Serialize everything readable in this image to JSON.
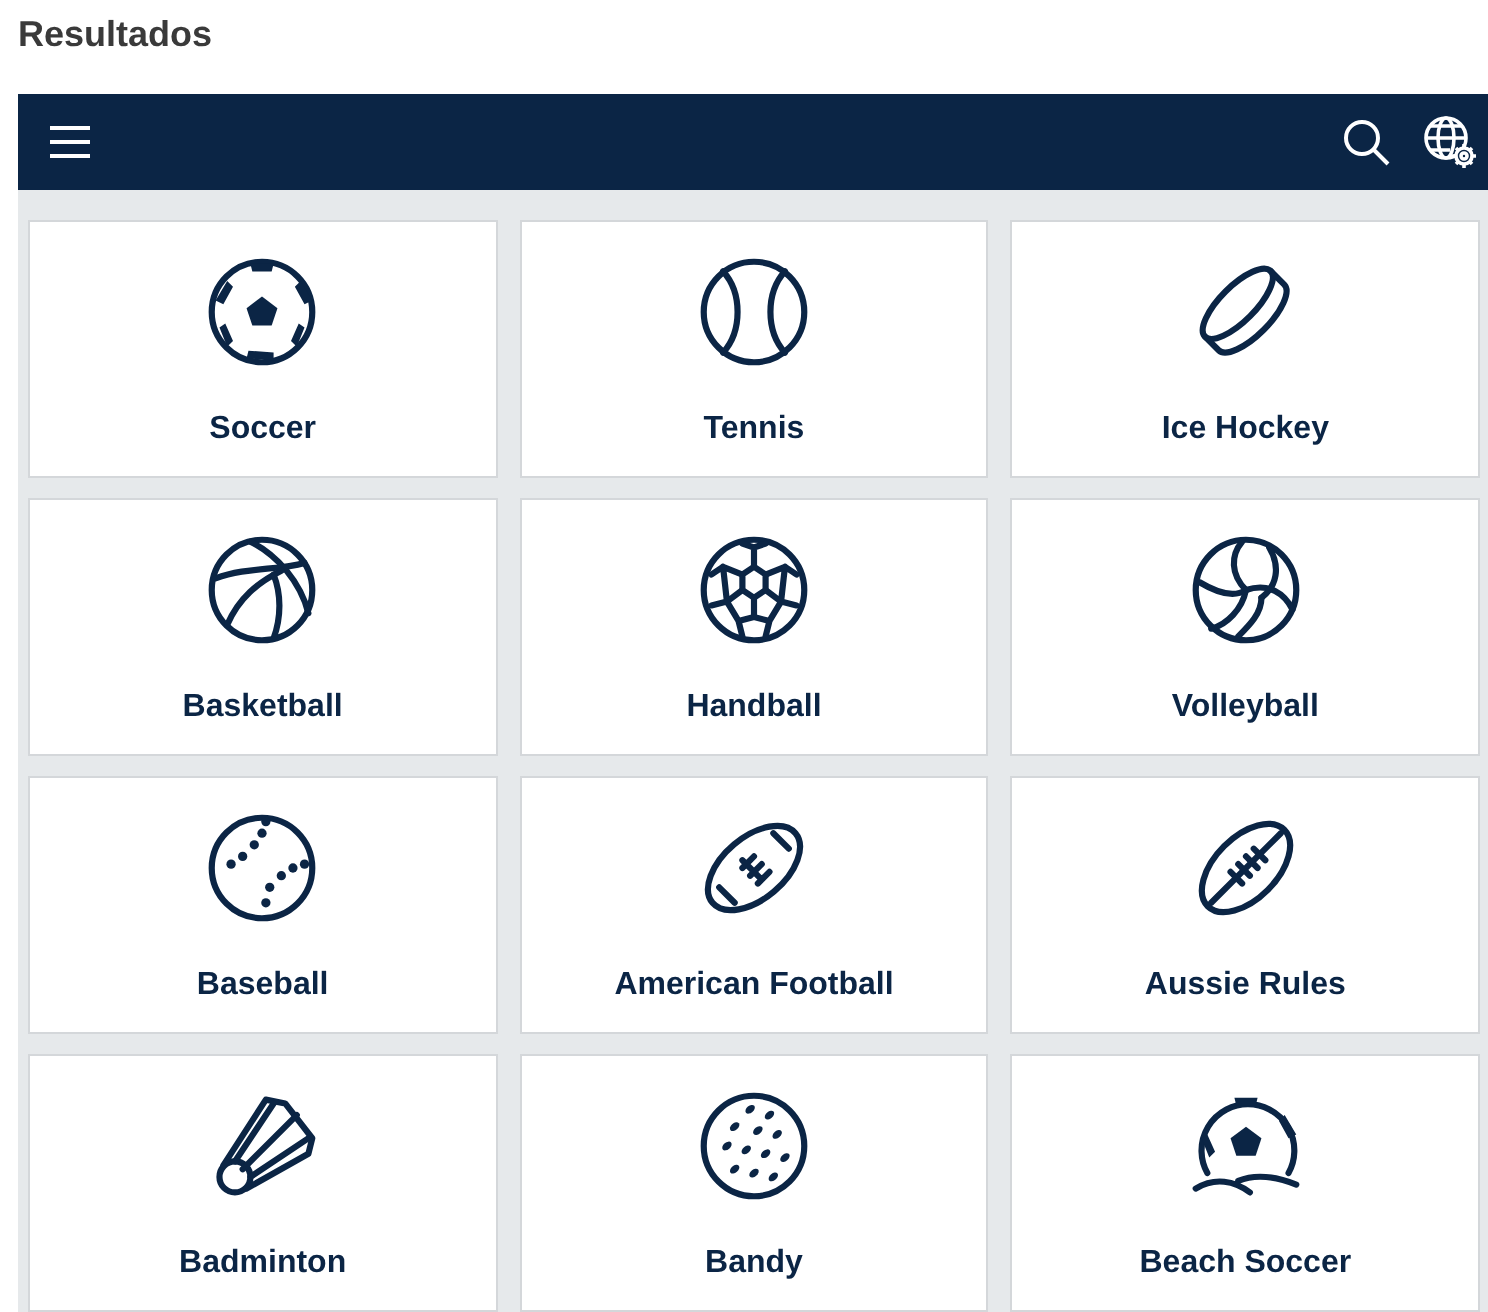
{
  "title": "Resultados",
  "sports": [
    {
      "label": "Soccer",
      "kind": "soccer"
    },
    {
      "label": "Tennis",
      "kind": "tennis"
    },
    {
      "label": "Ice Hockey",
      "kind": "puck"
    },
    {
      "label": "Basketball",
      "kind": "basketball"
    },
    {
      "label": "Handball",
      "kind": "handball"
    },
    {
      "label": "Volleyball",
      "kind": "volleyball"
    },
    {
      "label": "Baseball",
      "kind": "baseball"
    },
    {
      "label": "American Football",
      "kind": "american"
    },
    {
      "label": "Aussie Rules",
      "kind": "aussie"
    },
    {
      "label": "Badminton",
      "kind": "shuttlecock"
    },
    {
      "label": "Bandy",
      "kind": "bandy"
    },
    {
      "label": "Beach Soccer",
      "kind": "beach"
    }
  ]
}
